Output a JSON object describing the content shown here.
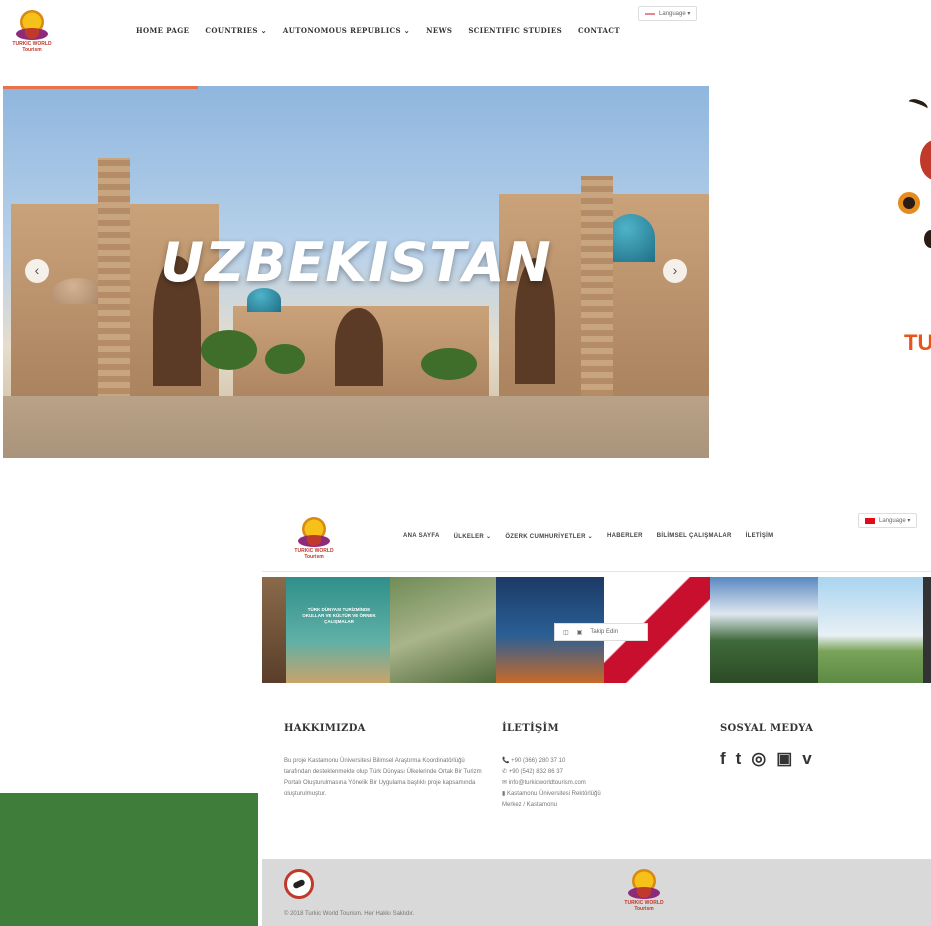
{
  "site": {
    "logo_text": "TURKIC WORLD Tourism",
    "nav": [
      "HOME PAGE",
      "COUNTRIES ⌄",
      "AUTONOMOUS REPUBLICS ⌄",
      "NEWS",
      "SCIENTIFIC STUDIES",
      "CONTACT"
    ],
    "language_label": "Language ▾"
  },
  "hero": {
    "title": "UZBEKISTAN",
    "prev_arrow": "‹",
    "next_arrow": "›"
  },
  "side_art": {
    "letters": "TU"
  },
  "turkish_site": {
    "nav": [
      "ANA SAYFA",
      "ÜLKELER ⌄",
      "ÖZERK CUMHURİYETLER ⌄",
      "HABERLER",
      "BİLİMSEL ÇALIŞMALAR",
      "İLETİŞİM"
    ],
    "language_label": "Language ▾",
    "gallery_caption": "TÜRK DÜNYASI TURİZMİNDE OKULLAR VE KÜLTÜR VE ÖRNEK ÇALIŞMALAR",
    "follow_label": "Takip Edin",
    "about": {
      "heading": "HAKKIMIZDA",
      "text": "Bu proje Kastamonu Üniversitesi Bilimsel Araştırma Koordinatörlüğü tarafından desteklenmekte olup Türk Dünyası Ülkelerinde Ortak Bir Turizm Portalı Oluşturulmasına Yönelik Bir Uygulama başlıklı proje kapsamında oluşturulmuştur."
    },
    "contact": {
      "heading": "İLETİŞİM",
      "phone": "📞 +90 (366) 280 37 10",
      "whatsapp": "✆ +90 (542) 832 86 37",
      "email": "✉ info@turkicworldtourism.com",
      "address1": "▮ Kastamonu Üniversitesi Rektörlüğü",
      "address2": "Merkez / Kastamonu"
    },
    "social": {
      "heading": "SOSYAL MEDYA",
      "icons": [
        "f",
        "t",
        "◎",
        "▣",
        "v"
      ]
    },
    "copyright": "© 2018 Turkic World Tourism. Her Hakkı Saklıdır."
  },
  "colors": {
    "accent_orange": "#e8734a",
    "footer_gray": "#d9d9d9",
    "green_block": "#3e7d3a"
  }
}
